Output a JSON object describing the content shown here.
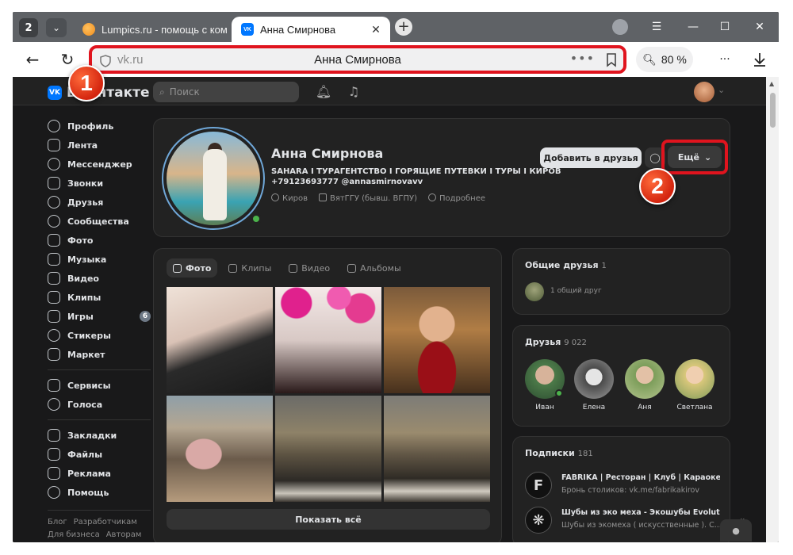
{
  "browser": {
    "tab_count": "2",
    "tabs": [
      {
        "title": "Lumpics.ru - помощь с ком",
        "active": false
      },
      {
        "title": "Анна Смирнова",
        "active": true
      }
    ],
    "address": {
      "domain": "vk.ru",
      "page_title": "Анна Смирнова"
    },
    "zoom": "80 %",
    "more_label": "..."
  },
  "annotations": {
    "step1": "1",
    "step2": "2",
    "highlight_color": "#e0141e"
  },
  "vk": {
    "logo_text": "ВКонтакте",
    "search_placeholder": "Поиск",
    "sidebar": {
      "main": [
        "Профиль",
        "Лента",
        "Мессенджер",
        "Звонки",
        "Друзья",
        "Сообщества",
        "Фото",
        "Музыка",
        "Видео",
        "Клипы",
        "Игры",
        "Стикеры",
        "Маркет"
      ],
      "games_count": "6",
      "services": [
        "Сервисы",
        "Голоса"
      ],
      "misc": [
        "Закладки",
        "Файлы",
        "Реклама",
        "Помощь"
      ],
      "footer": [
        "Блог",
        "Разработчикам",
        "Для бизнеса",
        "Авторам"
      ]
    },
    "profile": {
      "name": "Анна Смирнова",
      "status_line1": "SAHARA I ТУРАГЕНТСТВО I ГОРЯЩИЕ ПУТЕВКИ I ТУРЫ I КИРОВ",
      "status_line2": "+79123693777 @annasmirnovavv",
      "city": "Киров",
      "university": "ВятГГУ (бывш. ВГПУ)",
      "details": "Подробнее",
      "add_friend": "Добавить в друзья",
      "more": "Ещё"
    },
    "photos": {
      "tabs": [
        "Фото",
        "Клипы",
        "Видео",
        "Альбомы"
      ],
      "show_all": "Показать всё"
    },
    "mutual": {
      "title": "Общие друзья",
      "count": "1",
      "text": "1 общий друг"
    },
    "friends": {
      "title": "Друзья",
      "count": "9 022",
      "list": [
        "Иван",
        "Елена",
        "Аня",
        "Светлана"
      ]
    },
    "subscriptions": {
      "title": "Подписки",
      "count": "181",
      "items": [
        {
          "name": "FABRIKA | Ресторан | Клуб | Караоке | К...",
          "desc": "Бронь столиков: vk.me/fabrikakirov"
        },
        {
          "name": "Шубы из эко меха - Экошубы Evolution...",
          "desc": "Шубы из экомеха ( искусственные ). С..."
        }
      ]
    }
  }
}
